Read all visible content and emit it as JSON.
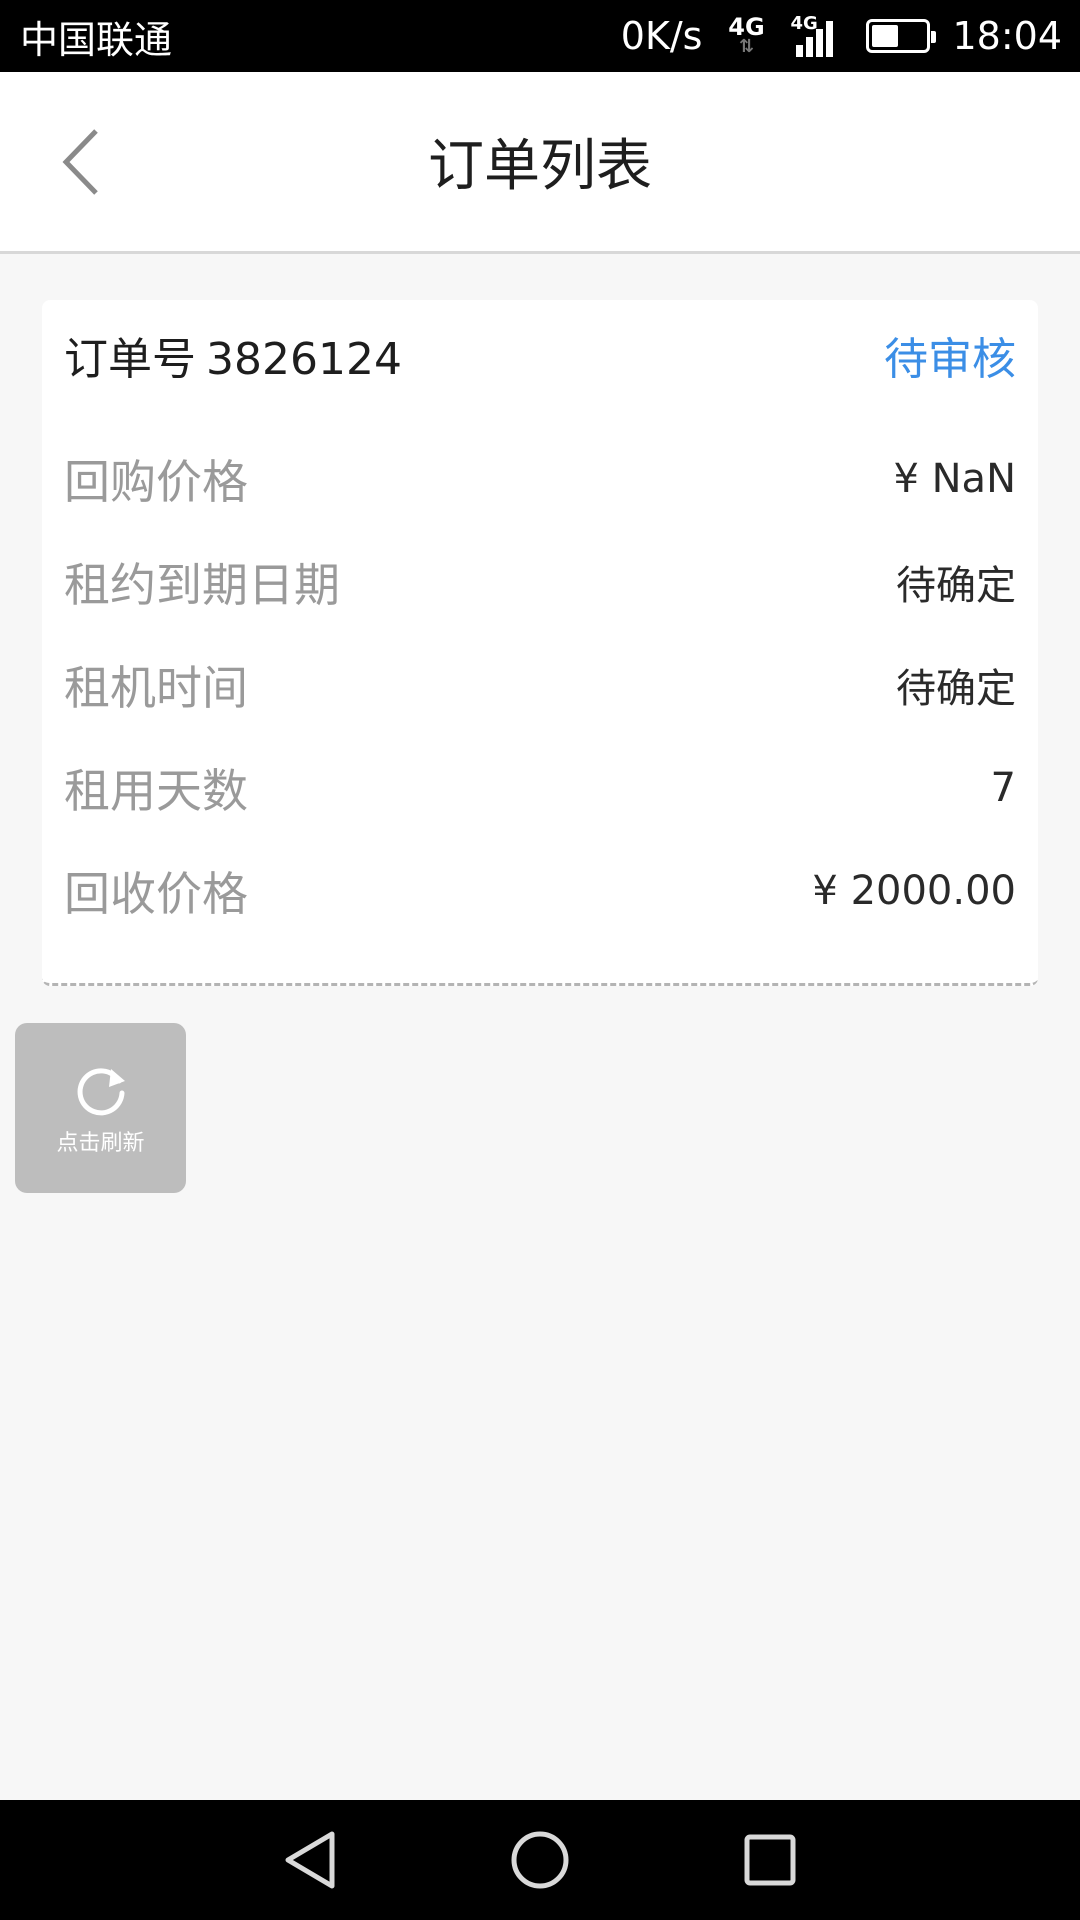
{
  "status_bar": {
    "carrier": "中国联通",
    "net_speed": "0K/s",
    "network_4g": "4G",
    "signal_4g": "4G",
    "time": "18:04",
    "battery_level": 0.5
  },
  "header": {
    "title": "订单列表",
    "back_icon": "chevron-left-icon"
  },
  "order": {
    "number_label": "订单号",
    "number": "3826124",
    "status": "待审核",
    "status_color": "#3b8ee6",
    "rows": [
      {
        "label": "回购价格",
        "value": "¥ NaN"
      },
      {
        "label": "租约到期日期",
        "value": "待确定"
      },
      {
        "label": "租机时间",
        "value": "待确定"
      },
      {
        "label": "租用天数",
        "value": "7"
      },
      {
        "label": "回收价格",
        "value": "¥ 2000.00"
      }
    ]
  },
  "refresh": {
    "label": "点击刷新",
    "icon": "refresh-icon"
  },
  "nav_bar": {
    "back": "triangle-back-icon",
    "home": "circle-home-icon",
    "recents": "square-recents-icon"
  }
}
